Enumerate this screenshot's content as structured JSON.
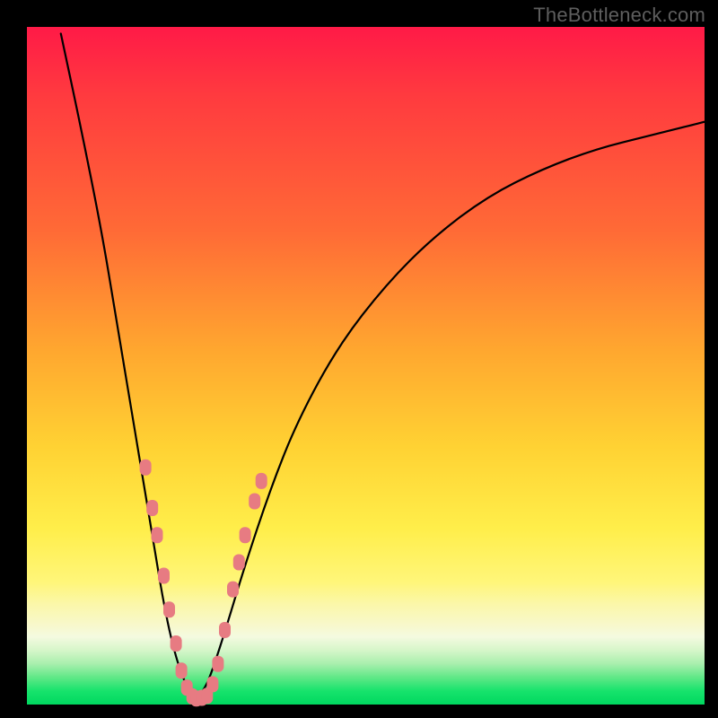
{
  "watermark": "TheBottleneck.com",
  "chart_data": {
    "type": "line",
    "title": "",
    "xlabel": "",
    "ylabel": "",
    "xlim": [
      0,
      100
    ],
    "ylim": [
      0,
      100
    ],
    "grid": false,
    "legend": false,
    "series": [
      {
        "name": "bottleneck-curve",
        "x": [
          5,
          8,
          11,
          13,
          15,
          17,
          19,
          20,
          21,
          22,
          23,
          24,
          25,
          26,
          27,
          29,
          32,
          36,
          40,
          46,
          53,
          60,
          68,
          76,
          84,
          92,
          100
        ],
        "y": [
          99,
          85,
          70,
          58,
          46,
          34,
          22,
          16,
          11,
          7,
          4,
          2,
          1,
          2,
          4,
          10,
          20,
          32,
          42,
          53,
          62,
          69,
          75,
          79,
          82,
          84,
          86
        ]
      }
    ],
    "markers": [
      {
        "name": "left-branch-dots",
        "shape": "rounded",
        "color": "#e77b82",
        "points": [
          {
            "x": 17.5,
            "y": 35
          },
          {
            "x": 18.5,
            "y": 29
          },
          {
            "x": 19.2,
            "y": 25
          },
          {
            "x": 20.2,
            "y": 19
          },
          {
            "x": 21.0,
            "y": 14
          },
          {
            "x": 22.0,
            "y": 9
          },
          {
            "x": 22.8,
            "y": 5
          },
          {
            "x": 23.6,
            "y": 2.5
          },
          {
            "x": 24.4,
            "y": 1.2
          }
        ]
      },
      {
        "name": "bottom-dots",
        "shape": "rounded",
        "color": "#e77b82",
        "points": [
          {
            "x": 25.0,
            "y": 0.9
          },
          {
            "x": 25.8,
            "y": 1.0
          },
          {
            "x": 26.6,
            "y": 1.3
          }
        ]
      },
      {
        "name": "right-branch-dots",
        "shape": "rounded",
        "color": "#e77b82",
        "points": [
          {
            "x": 27.4,
            "y": 3
          },
          {
            "x": 28.2,
            "y": 6
          },
          {
            "x": 29.2,
            "y": 11
          },
          {
            "x": 30.4,
            "y": 17
          },
          {
            "x": 31.3,
            "y": 21
          },
          {
            "x": 32.2,
            "y": 25
          },
          {
            "x": 33.6,
            "y": 30
          },
          {
            "x": 34.6,
            "y": 33
          }
        ]
      }
    ],
    "background_gradient": {
      "direction": "vertical",
      "stops": [
        {
          "pos": 0.0,
          "color": "#ff1a47"
        },
        {
          "pos": 0.3,
          "color": "#ff6a36"
        },
        {
          "pos": 0.62,
          "color": "#ffd233"
        },
        {
          "pos": 0.85,
          "color": "#fbf7a7"
        },
        {
          "pos": 1.0,
          "color": "#00d85f"
        }
      ]
    }
  }
}
